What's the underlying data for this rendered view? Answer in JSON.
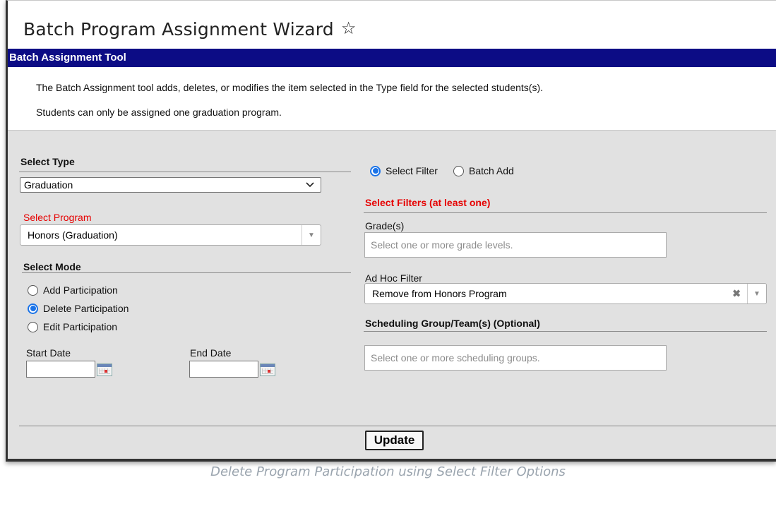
{
  "page": {
    "title": "Batch Program Assignment Wizard",
    "favorite_icon": "star-outline-icon"
  },
  "banner": {
    "title": "Batch Assignment Tool"
  },
  "description": {
    "line1": "The Batch Assignment tool adds, deletes, or modifies the item selected in the Type field for the selected students(s).",
    "line2": "Students can only be assigned one graduation program."
  },
  "select_type": {
    "heading": "Select Type",
    "value": "Graduation"
  },
  "select_program": {
    "label": "Select Program",
    "value": "Honors (Graduation)"
  },
  "select_mode": {
    "heading": "Select Mode",
    "options": [
      {
        "label": "Add Participation",
        "checked": false
      },
      {
        "label": "Delete Participation",
        "checked": true
      },
      {
        "label": "Edit Participation",
        "checked": false
      }
    ],
    "start_date_label": "Start Date",
    "end_date_label": "End Date",
    "start_date_value": "",
    "end_date_value": ""
  },
  "filter_mode": {
    "options": [
      {
        "label": "Select Filter",
        "checked": true
      },
      {
        "label": "Batch Add",
        "checked": false
      }
    ]
  },
  "filters": {
    "heading": "Select Filters (at least one)",
    "grades_label": "Grade(s)",
    "grades_placeholder": "Select one or more grade levels.",
    "adhoc_label": "Ad Hoc Filter",
    "adhoc_value": "Remove from Honors Program",
    "adhoc_clear": "✖",
    "scheduling_heading": "Scheduling Group/Team(s) (Optional)",
    "scheduling_placeholder": "Select one or more scheduling groups."
  },
  "actions": {
    "update_label": "Update"
  },
  "caption": "Delete Program Participation using Select Filter Options",
  "colors": {
    "banner": "#0c0c85",
    "required_label": "#e60000",
    "radio_checked": "#1a73e8",
    "panel": "#e1e1e1"
  }
}
